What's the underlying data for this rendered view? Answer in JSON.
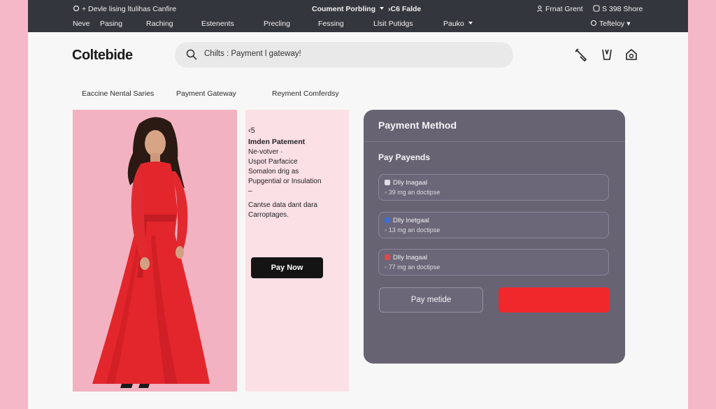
{
  "topbar": {
    "left_text": "+ Devle lising ltulihas Canfire",
    "center_text": "Coument Porbling",
    "center_extra": "›C6 Falde",
    "right_account": "Frnat Grent",
    "right_shore": "S 398 Shore",
    "nav": [
      {
        "label": "Neve"
      },
      {
        "label": "Pasing"
      },
      {
        "label": "Raching"
      },
      {
        "label": "Estenents"
      },
      {
        "label": "Precling"
      },
      {
        "label": "Fessing"
      },
      {
        "label": "Llsit Putidgs"
      },
      {
        "label": "Pauko"
      }
    ],
    "user_menu": "Tefteloy"
  },
  "header": {
    "logo": "Coltebide",
    "search_text": "Chilts : Payment l gateway!"
  },
  "subnav": [
    {
      "label": "Eaccine Nental Saries"
    },
    {
      "label": "Payment Gateway"
    },
    {
      "label": "Reyment Comferdsy"
    }
  ],
  "product": {
    "price": "‹5",
    "name": "Imden Patement",
    "lines": [
      "Ne-votver  ·",
      "Uspot Parfacice",
      "Somalon drig as",
      "Pupgential or Insulation",
      "–"
    ],
    "desc_1": "Cantse data dant dara",
    "desc_2": "Carroptages.",
    "pay_now": "Pay Now"
  },
  "payment": {
    "title": "Payment Method",
    "subtitle": "Pay Payends",
    "options": [
      {
        "name": "Dlly lnagaal",
        "detail": "◦ 39 mg an doctipse",
        "color": "#dedde4"
      },
      {
        "name": "Dlly lnetgaal",
        "detail": "◦ 13 mg an doctipse",
        "color": "#3b6fd6"
      },
      {
        "name": "Dlly lnagaal",
        "detail": "◦ 77 mg an doctipse",
        "color": "#e0494c"
      }
    ],
    "secondary_button": "Pay metide",
    "accent": "#f0282c"
  }
}
